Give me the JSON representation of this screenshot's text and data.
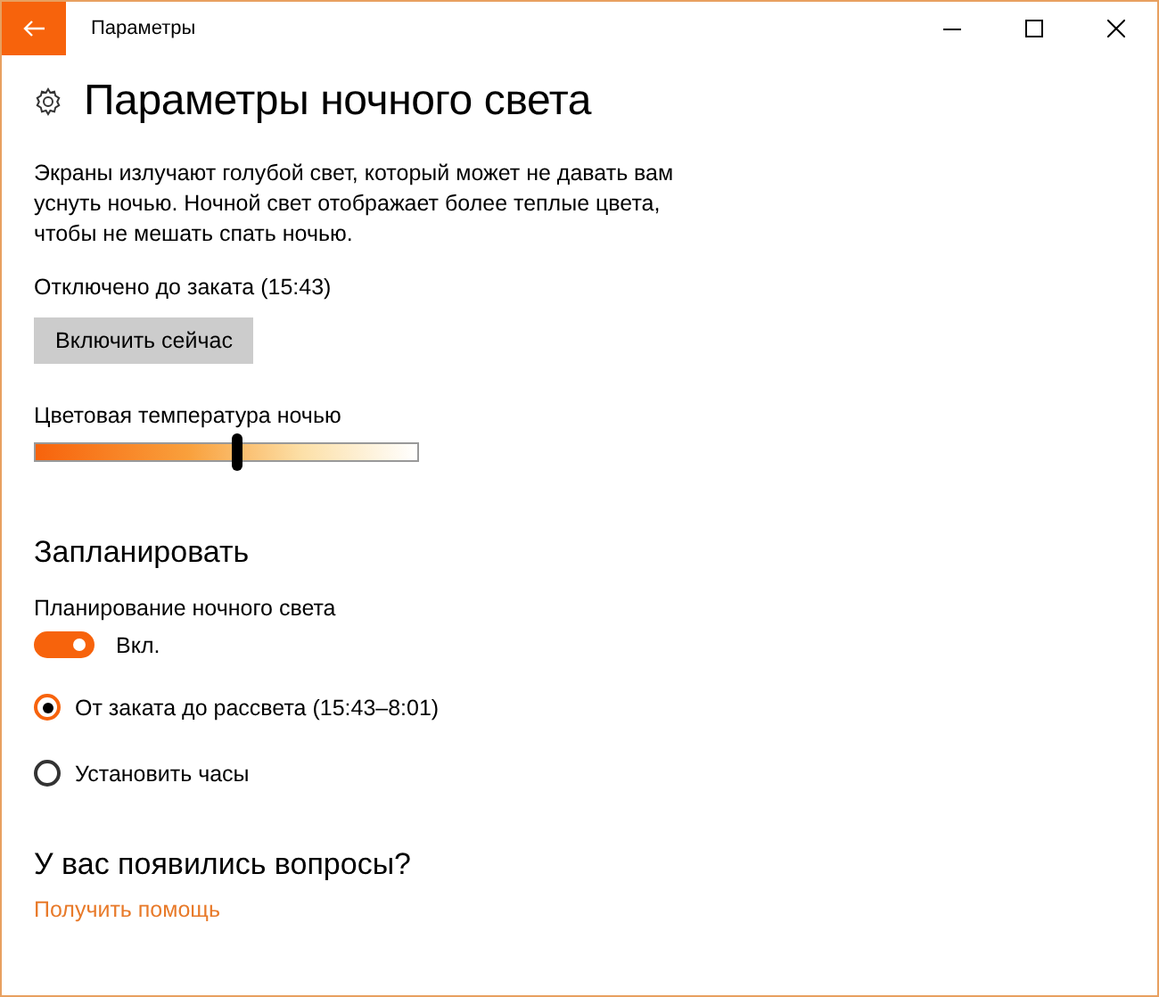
{
  "window": {
    "title": "Параметры"
  },
  "page": {
    "title": "Параметры ночного света"
  },
  "description": "Экраны излучают голубой свет, который может не давать вам уснуть ночью. Ночной свет отображает более теплые цвета, чтобы не мешать спать ночью.",
  "status": "Отключено до заката (15:43)",
  "action_button": "Включить сейчас",
  "temperature": {
    "label": "Цветовая температура ночью",
    "level": 0.53
  },
  "schedule": {
    "title": "Запланировать",
    "label": "Планирование ночного света",
    "toggle": {
      "on": true,
      "label": "Вкл."
    },
    "options": [
      {
        "label": "От заката до рассвета (15:43–8:01)",
        "selected": true
      },
      {
        "label": "Установить часы",
        "selected": false
      }
    ]
  },
  "help": {
    "title": "У вас появились вопросы?",
    "link": "Получить помощь"
  }
}
